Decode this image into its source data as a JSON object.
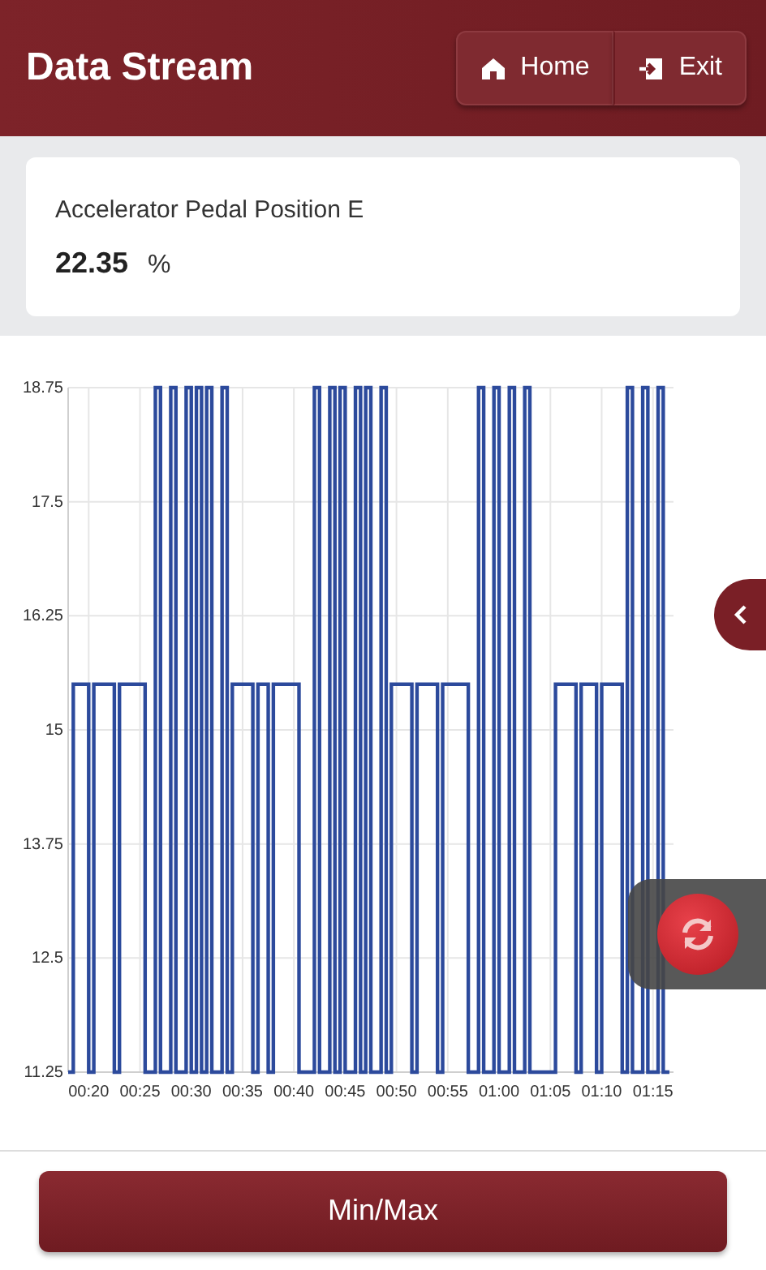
{
  "header": {
    "title": "Data Stream",
    "buttons": [
      {
        "kind": "home",
        "label": "Home"
      },
      {
        "kind": "exit",
        "label": "Exit"
      }
    ]
  },
  "reading": {
    "name": "Accelerator Pedal Position E",
    "value": "22.35",
    "unit": "%"
  },
  "chart_data": {
    "type": "line",
    "xlim": [
      18,
      77
    ],
    "ylim": [
      11.25,
      18.75
    ],
    "yticks": [
      {
        "value": 11.25,
        "label": "11.25"
      },
      {
        "value": 12.5,
        "label": "12.5"
      },
      {
        "value": 13.75,
        "label": "13.75"
      },
      {
        "value": 15,
        "label": "15"
      },
      {
        "value": 16.25,
        "label": "16.25"
      },
      {
        "value": 17.5,
        "label": "17.5"
      },
      {
        "value": 18.75,
        "label": "18.75"
      }
    ],
    "xticks": [
      {
        "value": 20,
        "label": "00:20"
      },
      {
        "value": 25,
        "label": "00:25"
      },
      {
        "value": 30,
        "label": "00:30"
      },
      {
        "value": 35,
        "label": "00:35"
      },
      {
        "value": 40,
        "label": "00:40"
      },
      {
        "value": 45,
        "label": "00:45"
      },
      {
        "value": 50,
        "label": "00:50"
      },
      {
        "value": 55,
        "label": "00:55"
      },
      {
        "value": 60,
        "label": "01:00"
      },
      {
        "value": 65,
        "label": "01:05"
      },
      {
        "value": 70,
        "label": "01:10"
      },
      {
        "value": 75,
        "label": "01:15"
      }
    ],
    "grid": true,
    "x": [
      18,
      18.5,
      18.5,
      20,
      20,
      20.5,
      20.5,
      22.5,
      22.5,
      23,
      23,
      25.5,
      25.5,
      26.5,
      26.5,
      27,
      27,
      28,
      28,
      28.5,
      28.5,
      29.5,
      29.5,
      30,
      30,
      30.5,
      30.5,
      31,
      31,
      31.5,
      31.5,
      32,
      32,
      33,
      33,
      33.5,
      33.5,
      34,
      34,
      36,
      36,
      36.5,
      36.5,
      37.5,
      37.5,
      38,
      38,
      40.5,
      40.5,
      42,
      42,
      42.5,
      42.5,
      43.5,
      43.5,
      44,
      44,
      44.5,
      44.5,
      45,
      45,
      46,
      46,
      46.5,
      46.5,
      47,
      47,
      47.5,
      47.5,
      48.5,
      48.5,
      49,
      49,
      49.5,
      49.5,
      51.5,
      51.5,
      52,
      52,
      54,
      54,
      54.5,
      54.5,
      57,
      57,
      58,
      58,
      58.5,
      58.5,
      59.5,
      59.5,
      60,
      60,
      61,
      61,
      61.5,
      61.5,
      62.5,
      62.5,
      63,
      63,
      65.5,
      65.5,
      67.5,
      67.5,
      68,
      68,
      69.5,
      69.5,
      70,
      70,
      72,
      72,
      72.5,
      72.5,
      73,
      73,
      74,
      74,
      74.5,
      74.5,
      75.5,
      75.5,
      76,
      76,
      76.6
    ],
    "series": [
      {
        "color": "#2c4a9c",
        "values": [
          11.25,
          11.25,
          15.5,
          15.5,
          11.25,
          11.25,
          15.5,
          15.5,
          11.25,
          11.25,
          15.5,
          15.5,
          11.25,
          11.25,
          18.75,
          18.75,
          11.25,
          11.25,
          18.75,
          18.75,
          11.25,
          11.25,
          18.75,
          18.75,
          11.25,
          11.25,
          18.75,
          18.75,
          11.25,
          11.25,
          18.75,
          18.75,
          11.25,
          11.25,
          18.75,
          18.75,
          11.25,
          11.25,
          15.5,
          15.5,
          11.25,
          11.25,
          15.5,
          15.5,
          11.25,
          11.25,
          15.5,
          15.5,
          11.25,
          11.25,
          18.75,
          18.75,
          11.25,
          11.25,
          18.75,
          18.75,
          11.25,
          11.25,
          18.75,
          18.75,
          11.25,
          11.25,
          18.75,
          18.75,
          11.25,
          11.25,
          18.75,
          18.75,
          11.25,
          11.25,
          18.75,
          18.75,
          11.25,
          11.25,
          15.5,
          15.5,
          11.25,
          11.25,
          15.5,
          15.5,
          11.25,
          11.25,
          15.5,
          15.5,
          11.25,
          11.25,
          18.75,
          18.75,
          11.25,
          11.25,
          18.75,
          18.75,
          11.25,
          11.25,
          18.75,
          18.75,
          11.25,
          11.25,
          18.75,
          18.75,
          11.25,
          11.25,
          15.5,
          15.5,
          11.25,
          11.25,
          15.5,
          15.5,
          11.25,
          11.25,
          15.5,
          15.5,
          11.25,
          11.25,
          18.75,
          18.75,
          11.25,
          11.25,
          18.75,
          18.75,
          11.25,
          11.25,
          18.75,
          18.75,
          11.25,
          11.25
        ]
      }
    ]
  },
  "footer": {
    "button": "Min/Max"
  }
}
